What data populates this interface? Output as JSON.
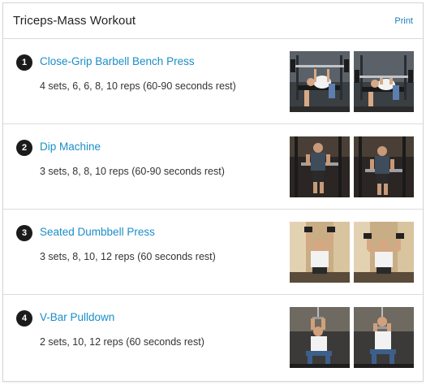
{
  "header": {
    "title": "Triceps-Mass Workout",
    "print_label": "Print"
  },
  "exercises": [
    {
      "num": "1",
      "name": "Close-Grip Barbell Bench Press",
      "sets": "4 sets, 6, 6, 8, 10 reps (60-90 seconds rest)"
    },
    {
      "num": "2",
      "name": "Dip Machine",
      "sets": "3 sets, 8, 8, 10 reps (60-90 seconds rest)"
    },
    {
      "num": "3",
      "name": "Seated Dumbbell Press",
      "sets": "3 sets, 8, 10, 12 reps (60 seconds rest)"
    },
    {
      "num": "4",
      "name": "V-Bar Pulldown",
      "sets": "2 sets, 10, 12 reps (60 seconds rest)"
    }
  ]
}
